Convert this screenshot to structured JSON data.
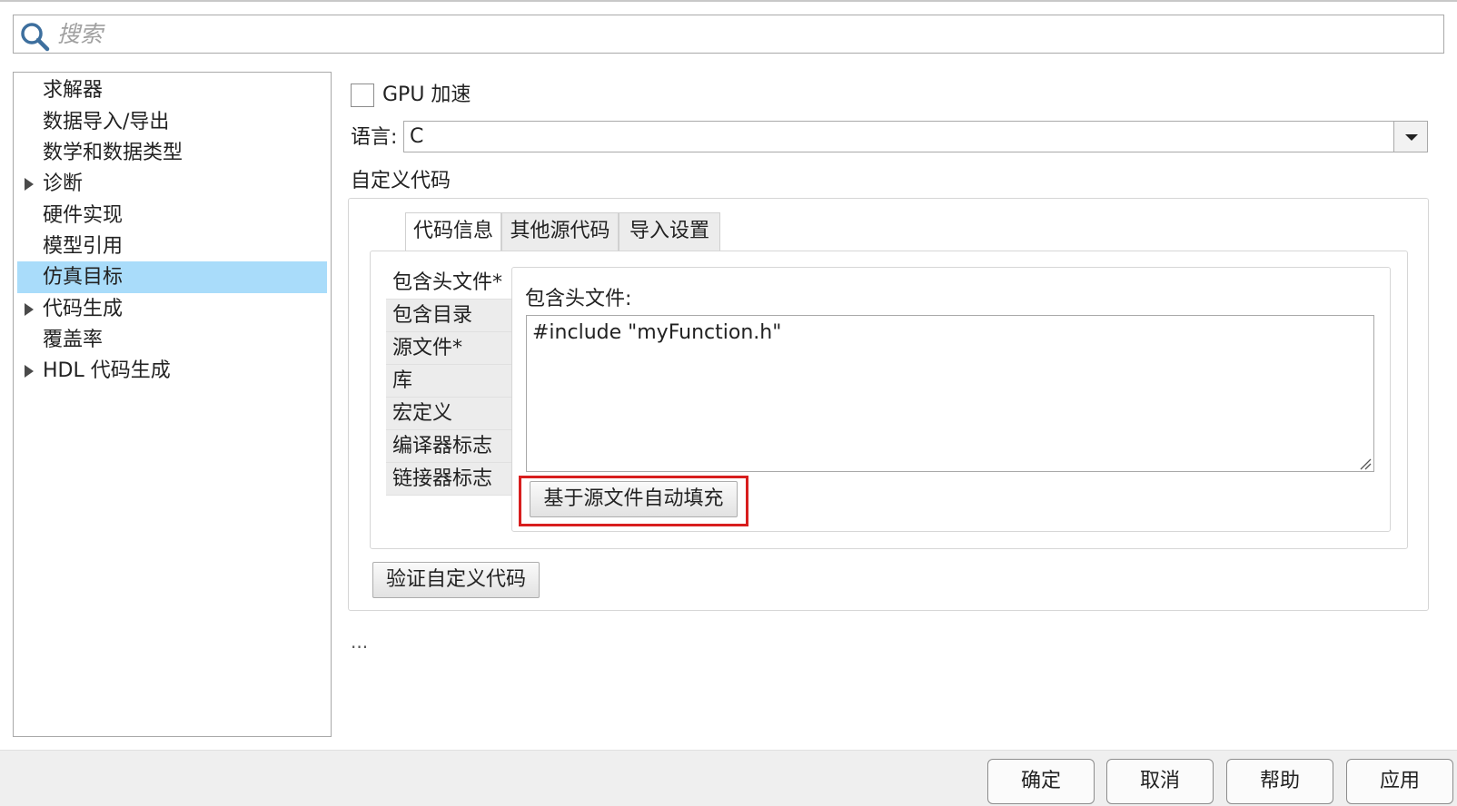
{
  "search": {
    "placeholder": "搜索",
    "icon": "search-icon"
  },
  "tree": {
    "items": [
      {
        "label": "求解器",
        "expandable": false
      },
      {
        "label": "数据导入/导出",
        "expandable": false
      },
      {
        "label": "数学和数据类型",
        "expandable": false
      },
      {
        "label": "诊断",
        "expandable": true
      },
      {
        "label": "硬件实现",
        "expandable": false
      },
      {
        "label": "模型引用",
        "expandable": false
      },
      {
        "label": "仿真目标",
        "expandable": false,
        "selected": true
      },
      {
        "label": "代码生成",
        "expandable": true
      },
      {
        "label": "覆盖率",
        "expandable": false
      },
      {
        "label": "HDL 代码生成",
        "expandable": true
      }
    ],
    "selected_color": "#a9dcfa"
  },
  "main": {
    "gpu_label": "GPU 加速",
    "gpu_checked": false,
    "language_label": "语言:",
    "language_value": "C",
    "custom_code_title": "自定义代码",
    "tabs": [
      {
        "label": "代码信息",
        "active": true
      },
      {
        "label": "其他源代码",
        "active": false
      },
      {
        "label": "导入设置",
        "active": false
      }
    ],
    "subtabs": [
      {
        "label": "包含头文件*",
        "active": true
      },
      {
        "label": "包含目录",
        "active": false
      },
      {
        "label": "源文件*",
        "active": false
      },
      {
        "label": "库",
        "active": false
      },
      {
        "label": "宏定义",
        "active": false
      },
      {
        "label": "编译器标志",
        "active": false
      },
      {
        "label": "链接器标志",
        "active": false
      }
    ],
    "header_files_label": "包含头文件:",
    "header_files_value": "#include \"myFunction.h\"",
    "autofill_button": "基于源文件自动填充",
    "highlight_color": "#d81e1e",
    "verify_button": "验证自定义代码",
    "ellipsis": "..."
  },
  "footer": {
    "ok": "确定",
    "cancel": "取消",
    "help": "帮助",
    "apply": "应用"
  }
}
